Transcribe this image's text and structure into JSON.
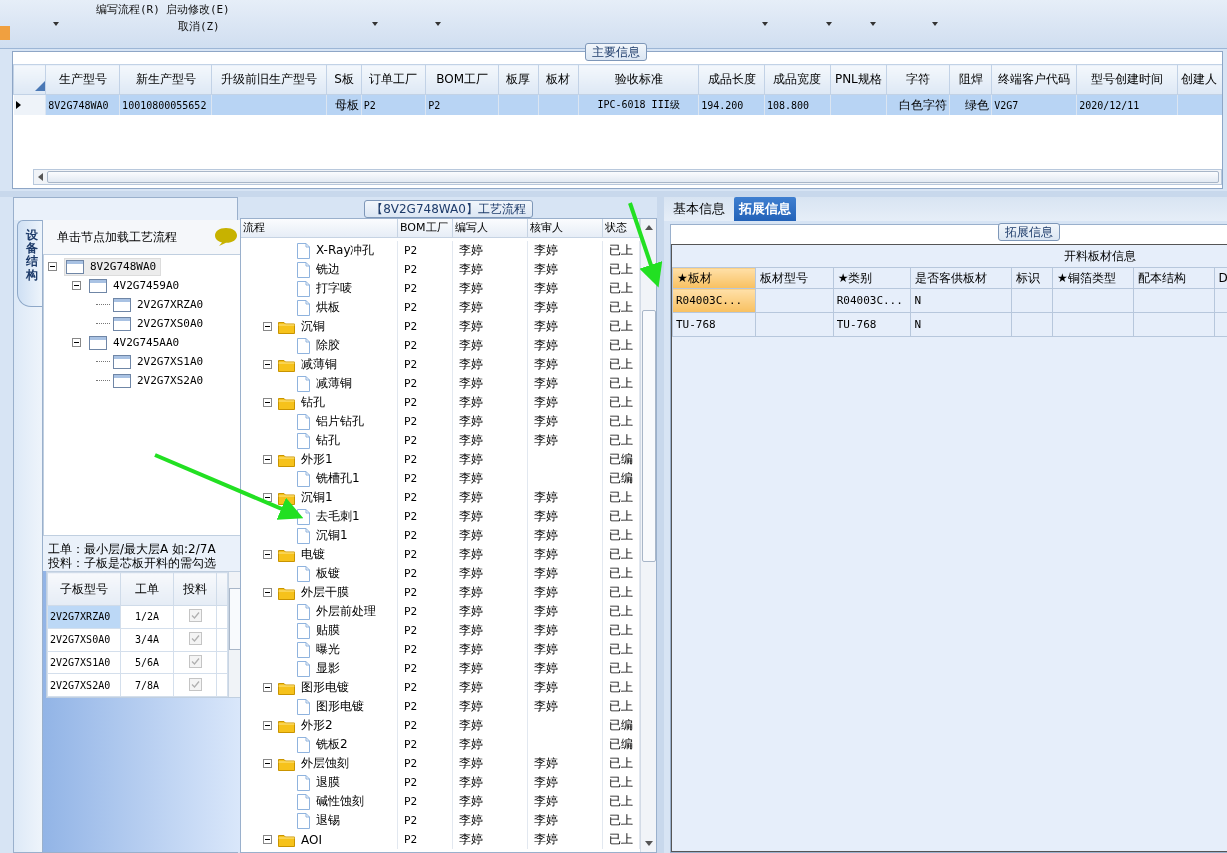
{
  "toolbar": {
    "items": [
      {
        "label": "编写流程(R)"
      },
      {
        "label": "启动修改(E)"
      },
      {
        "label": "取消(Z)"
      }
    ]
  },
  "main_info": {
    "title": "主要信息",
    "columns": [
      "生产型号",
      "新生产型号",
      "升级前旧生产型号",
      "S板",
      "订单工厂",
      "BOM工厂",
      "板厚",
      "板材",
      "验收标准",
      "成品长度",
      "成品宽度",
      "PNL规格",
      "字符",
      "阻焊",
      "终端客户代码",
      "型号创建时间",
      "创建人"
    ],
    "rows": [
      {
        "selected": true,
        "cells": [
          "8V2G748WA0",
          "10010800055652",
          "",
          "母板",
          "P2",
          "P2",
          "",
          "",
          "IPC-6018 III级",
          "194.200",
          "108.800",
          "",
          "白色字符",
          "绿色",
          "V2G7",
          "2020/12/11",
          ""
        ]
      }
    ]
  },
  "structure": {
    "tab": "设备结构",
    "header": "单击节点加载工艺流程",
    "tree": [
      {
        "label": "8V2G748WA0",
        "selected": true,
        "expanded": true,
        "children": [
          {
            "label": "4V2G7459A0",
            "selected": false,
            "expanded": true,
            "children": [
              {
                "label": "2V2G7XRZA0",
                "selected": false
              },
              {
                "label": "2V2G7XS0A0",
                "selected": false
              }
            ]
          },
          {
            "label": "4V2G745AA0",
            "selected": false,
            "expanded": true,
            "children": [
              {
                "label": "2V2G7XS1A0",
                "selected": false
              },
              {
                "label": "2V2G7XS2A0",
                "selected": false
              }
            ]
          }
        ]
      }
    ],
    "note": [
      "工单：最小层/最大层A 如:2/7A",
      "投料：子板是芯板开料的需勾选"
    ],
    "sub_table": {
      "columns": [
        "子板型号",
        "工单",
        "投料"
      ],
      "rows": [
        {
          "model": "2V2G7XRZA0",
          "order": "1/2A",
          "checked": true,
          "disabled": true,
          "selected": true
        },
        {
          "model": "2V2G7XS0A0",
          "order": "3/4A",
          "checked": true,
          "disabled": true,
          "selected": false
        },
        {
          "model": "2V2G7XS1A0",
          "order": "5/6A",
          "checked": true,
          "disabled": true,
          "selected": false
        },
        {
          "model": "2V2G7XS2A0",
          "order": "7/8A",
          "checked": true,
          "disabled": true,
          "selected": false
        }
      ]
    }
  },
  "process": {
    "title": "【8V2G748WA0】工艺流程",
    "columns": [
      "流程",
      "BOM工厂",
      "编写人",
      "核审人",
      "状态"
    ],
    "groups": [
      {
        "children": [
          {
            "name": "X-Ray冲孔",
            "factory": "P2",
            "writer": "李婷",
            "reviewer": "李婷",
            "status": "已上"
          },
          {
            "name": "铣边",
            "factory": "P2",
            "writer": "李婷",
            "reviewer": "李婷",
            "status": "已上"
          },
          {
            "name": "打字唛",
            "factory": "P2",
            "writer": "李婷",
            "reviewer": "李婷",
            "status": "已上"
          },
          {
            "name": "烘板",
            "factory": "P2",
            "writer": "李婷",
            "reviewer": "李婷",
            "status": "已上"
          }
        ]
      },
      {
        "name": "沉铜",
        "factory": "P2",
        "writer": "李婷",
        "reviewer": "李婷",
        "status": "已上",
        "expanded": true,
        "children": [
          {
            "name": "除胶",
            "factory": "P2",
            "writer": "李婷",
            "reviewer": "李婷",
            "status": "已上"
          }
        ]
      },
      {
        "name": "减薄铜",
        "factory": "P2",
        "writer": "李婷",
        "reviewer": "李婷",
        "status": "已上",
        "expanded": true,
        "children": [
          {
            "name": "减薄铜",
            "factory": "P2",
            "writer": "李婷",
            "reviewer": "李婷",
            "status": "已上"
          }
        ]
      },
      {
        "name": "钻孔",
        "factory": "P2",
        "writer": "李婷",
        "reviewer": "李婷",
        "status": "已上",
        "expanded": true,
        "children": [
          {
            "name": "铝片钻孔",
            "factory": "P2",
            "writer": "李婷",
            "reviewer": "李婷",
            "status": "已上"
          },
          {
            "name": "钻孔",
            "factory": "P2",
            "writer": "李婷",
            "reviewer": "李婷",
            "status": "已上"
          }
        ]
      },
      {
        "name": "外形1",
        "factory": "P2",
        "writer": "李婷",
        "status": "已编",
        "expanded": true,
        "children": [
          {
            "name": "铣槽孔1",
            "factory": "P2",
            "writer": "李婷",
            "status": "已编"
          }
        ]
      },
      {
        "name": "沉铜1",
        "factory": "P2",
        "writer": "李婷",
        "reviewer": "李婷",
        "status": "已上",
        "expanded": true,
        "children": [
          {
            "name": "去毛刺1",
            "factory": "P2",
            "writer": "李婷",
            "reviewer": "李婷",
            "status": "已上"
          },
          {
            "name": "沉铜1",
            "factory": "P2",
            "writer": "李婷",
            "reviewer": "李婷",
            "status": "已上"
          }
        ]
      },
      {
        "name": "电镀",
        "factory": "P2",
        "writer": "李婷",
        "reviewer": "李婷",
        "status": "已上",
        "expanded": true,
        "children": [
          {
            "name": "板镀",
            "factory": "P2",
            "writer": "李婷",
            "reviewer": "李婷",
            "status": "已上"
          }
        ]
      },
      {
        "name": "外层干膜",
        "factory": "P2",
        "writer": "李婷",
        "reviewer": "李婷",
        "status": "已上",
        "expanded": true,
        "children": [
          {
            "name": "外层前处理",
            "factory": "P2",
            "writer": "李婷",
            "reviewer": "李婷",
            "status": "已上"
          },
          {
            "name": "贴膜",
            "factory": "P2",
            "writer": "李婷",
            "reviewer": "李婷",
            "status": "已上"
          },
          {
            "name": "曝光",
            "factory": "P2",
            "writer": "李婷",
            "reviewer": "李婷",
            "status": "已上"
          },
          {
            "name": "显影",
            "factory": "P2",
            "writer": "李婷",
            "reviewer": "李婷",
            "status": "已上"
          }
        ]
      },
      {
        "name": "图形电镀",
        "factory": "P2",
        "writer": "李婷",
        "reviewer": "李婷",
        "status": "已上",
        "expanded": true,
        "children": [
          {
            "name": "图形电镀",
            "factory": "P2",
            "writer": "李婷",
            "reviewer": "李婷",
            "status": "已上"
          }
        ]
      },
      {
        "name": "外形2",
        "factory": "P2",
        "writer": "李婷",
        "status": "已编",
        "expanded": true,
        "children": [
          {
            "name": "铣板2",
            "factory": "P2",
            "writer": "李婷",
            "status": "已编"
          }
        ]
      },
      {
        "name": "外层蚀刻",
        "factory": "P2",
        "writer": "李婷",
        "reviewer": "李婷",
        "status": "已上",
        "expanded": true,
        "children": [
          {
            "name": "退膜",
            "factory": "P2",
            "writer": "李婷",
            "reviewer": "李婷",
            "status": "已上"
          },
          {
            "name": "碱性蚀刻",
            "factory": "P2",
            "writer": "李婷",
            "reviewer": "李婷",
            "status": "已上"
          },
          {
            "name": "退锡",
            "factory": "P2",
            "writer": "李婷",
            "reviewer": "李婷",
            "status": "已上"
          }
        ]
      },
      {
        "name": "AOI",
        "factory": "P2",
        "writer": "李婷",
        "reviewer": "李婷",
        "status": "已上",
        "expanded": true
      }
    ]
  },
  "detail": {
    "tabs": [
      {
        "label": "基本信息",
        "selected": false
      },
      {
        "label": "拓展信息",
        "selected": true
      }
    ],
    "group_title": "拓展信息",
    "caption": "开料板材信息",
    "columns": [
      "★板材",
      "板材型号",
      "★类别",
      "是否客供板材",
      "标识",
      "★铜箔类型",
      "配本结构",
      "D"
    ],
    "rows": [
      {
        "selected": true,
        "cells": [
          "R04003C...",
          "",
          "R04003C...",
          "N",
          "",
          "",
          "",
          ""
        ]
      },
      {
        "selected": false,
        "cells": [
          "TU-768",
          "",
          "TU-768",
          "N",
          "",
          "",
          "",
          ""
        ]
      }
    ]
  }
}
